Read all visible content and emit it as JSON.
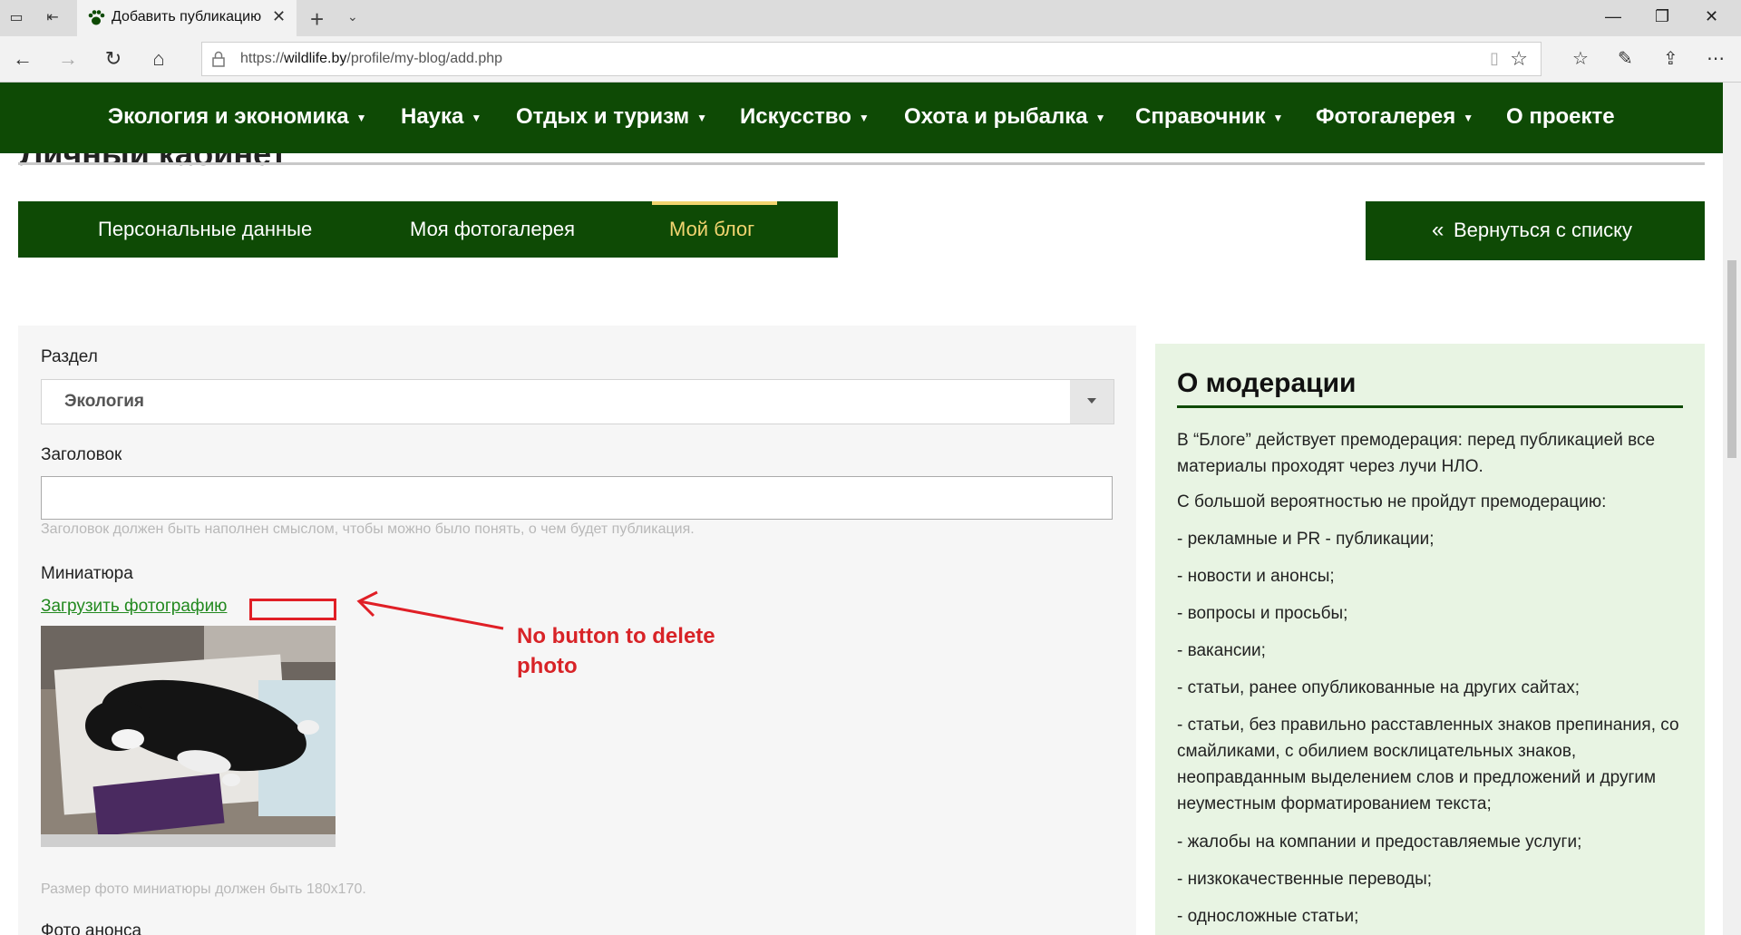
{
  "browser": {
    "tab_title": "Добавить публикацию",
    "url_prefix": "https://",
    "url_host": "wildlife.by",
    "url_path": "/profile/my-blog/add.php"
  },
  "nav": {
    "items": [
      {
        "label": "Экология и экономика",
        "has_dropdown": true
      },
      {
        "label": "Наука",
        "has_dropdown": true
      },
      {
        "label": "Отдых и туризм",
        "has_dropdown": true
      },
      {
        "label": "Искусство",
        "has_dropdown": true
      },
      {
        "label": "Охота и рыбалка",
        "has_dropdown": true
      },
      {
        "label": "Справочник",
        "has_dropdown": true
      },
      {
        "label": "Фотогалерея",
        "has_dropdown": true
      },
      {
        "label": "О проекте",
        "has_dropdown": false
      }
    ],
    "caret": "▼"
  },
  "page": {
    "heading_partial": "Личный кабинет"
  },
  "profile_tabs": [
    {
      "label": "Персональные данные",
      "active": false
    },
    {
      "label": "Моя фотогалерея",
      "active": false
    },
    {
      "label": "Мой блог",
      "active": true
    }
  ],
  "back_button": {
    "icon": "«",
    "label": "Вернуться с списку"
  },
  "form": {
    "section_label": "Раздел",
    "section_value": "Экология",
    "title_label": "Заголовок",
    "title_value": "",
    "title_hint": "Заголовок должен быть наполнен смыслом, чтобы можно было понять, о чем будет публикация.",
    "thumb_label": "Миниатюра",
    "upload_link": "Загрузить фотографию",
    "thumb_hint": "Размер фото миниатюры должен быть 180х170.",
    "announce_label": "Фото анонса"
  },
  "annotation": {
    "text_line1": "No button to delete",
    "text_line2": "photo",
    "color": "#d82327"
  },
  "moderation": {
    "title": "О модерации",
    "paragraphs": [
      "В “Блоге” действует премодерация: перед публикацией все материалы проходят через лучи НЛО.",
      "С большой вероятностью не пройдут премодерацию:",
      "- рекламные и PR - публикации;",
      "- новости и анонсы;",
      "- вопросы и просьбы;",
      "- вакансии;",
      "- статьи, ранее опубликованные на других сайтах;",
      "- статьи, без правильно расставленных знаков препинания, со смайликами, с обилием восклицательных знаков, неоправданным выделением слов и предложений и другим неуместным форматированием текста;",
      "- жалобы на компании и предоставляемые услуги;",
      "- низкокачественные переводы;",
      "- односложные статьи;"
    ]
  },
  "colors": {
    "brand_green": "#0e4a05",
    "active_tab": "#f2d470",
    "link_green": "#22891f",
    "moderation_bg": "#e8f4e3"
  },
  "icons": [
    "paw-favicon-icon",
    "back-arrow-icon",
    "forward-arrow-icon",
    "refresh-icon",
    "home-icon",
    "lock-icon",
    "reading-view-icon",
    "star-icon",
    "favorites-icon",
    "pen-icon",
    "share-icon",
    "more-icon"
  ]
}
